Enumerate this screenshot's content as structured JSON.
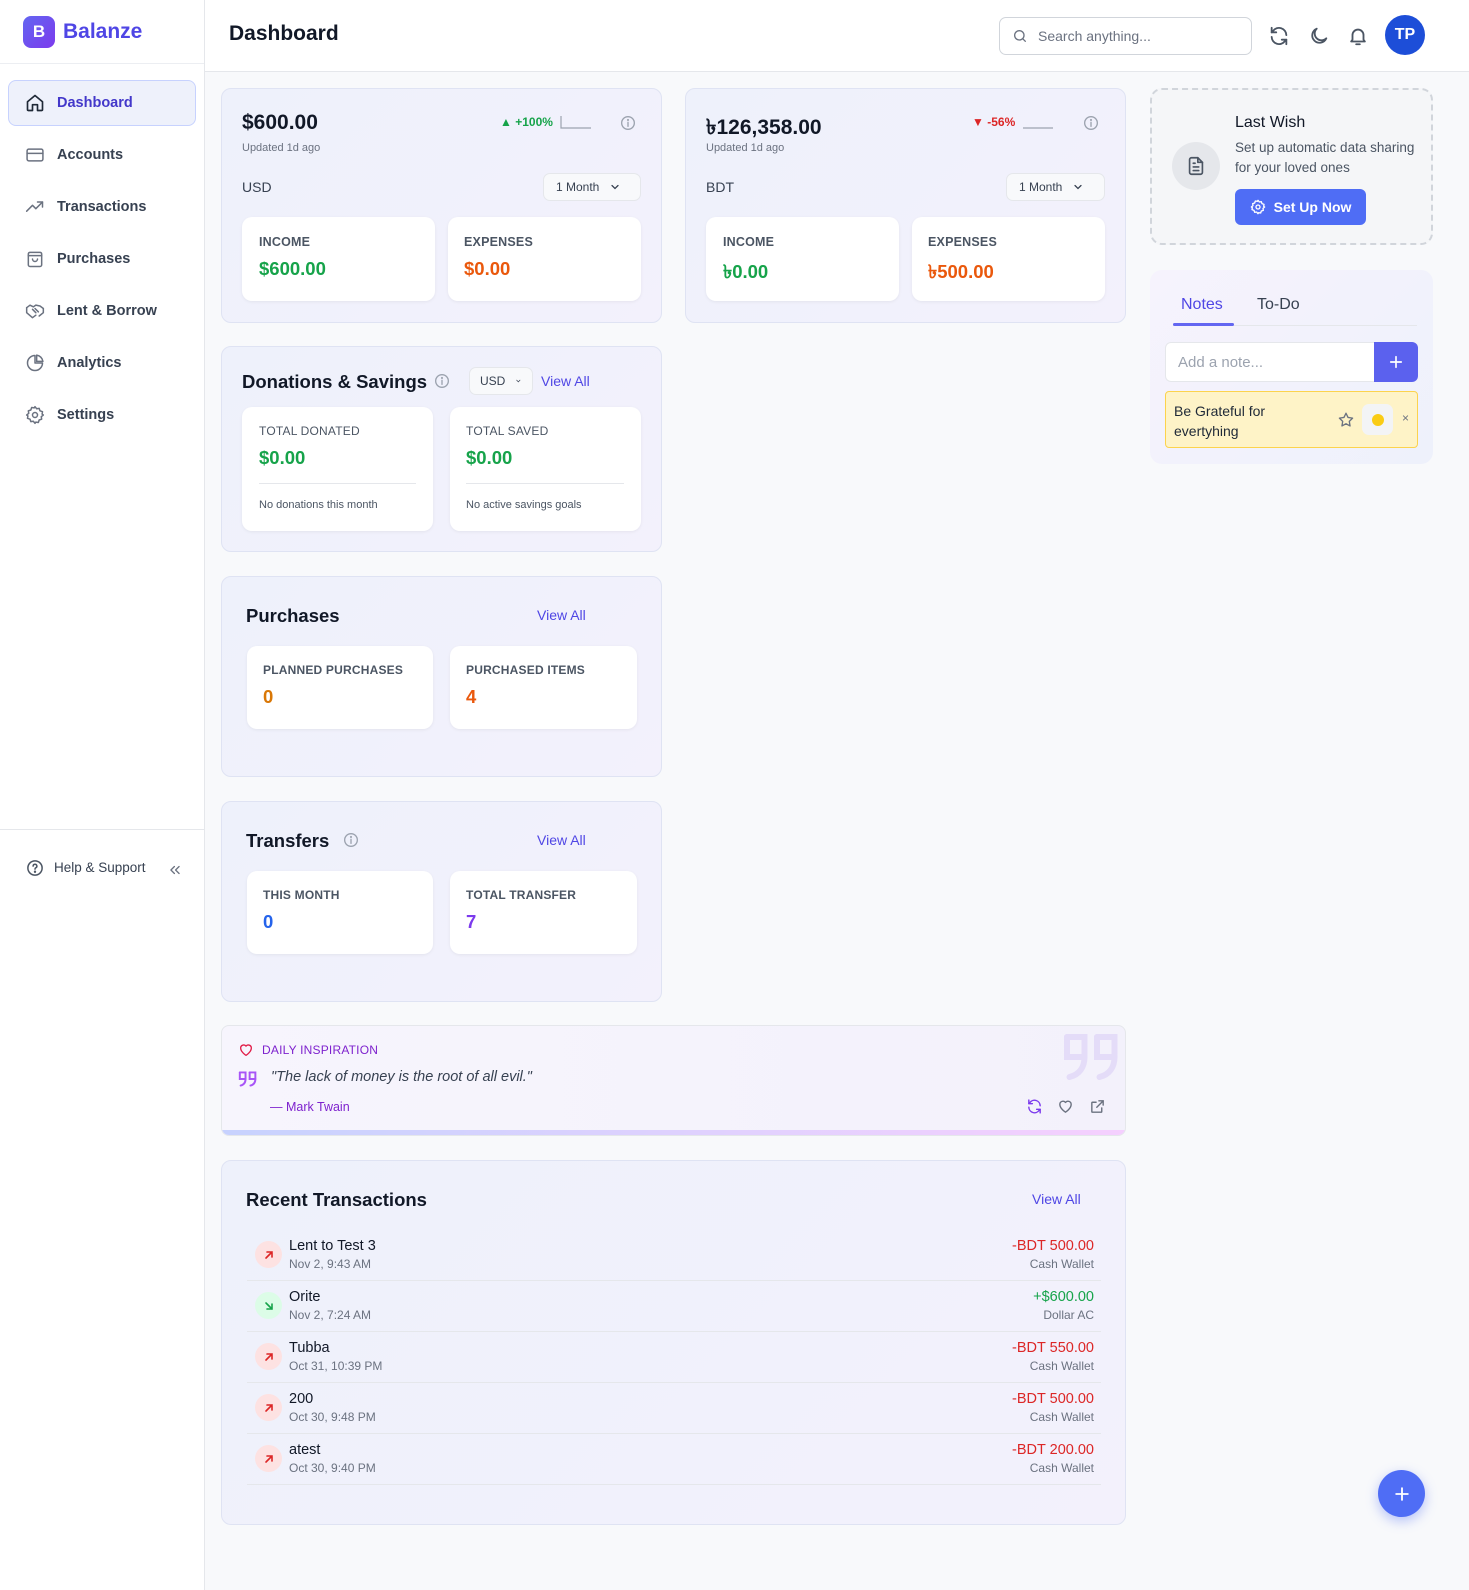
{
  "brand": {
    "logo_letter": "B",
    "name": "Balanze"
  },
  "sidebar": {
    "items": [
      {
        "label": "Dashboard",
        "icon": "home-icon",
        "active": true
      },
      {
        "label": "Accounts",
        "icon": "credit-card-icon"
      },
      {
        "label": "Transactions",
        "icon": "trending-up-icon"
      },
      {
        "label": "Purchases",
        "icon": "shopping-bag-icon"
      },
      {
        "label": "Lent & Borrow",
        "icon": "handshake-icon"
      },
      {
        "label": "Analytics",
        "icon": "pie-chart-icon"
      },
      {
        "label": "Settings",
        "icon": "gear-icon"
      }
    ],
    "help_label": "Help & Support"
  },
  "header": {
    "title": "Dashboard",
    "search_placeholder": "Search anything...",
    "avatar_initials": "TP"
  },
  "accounts": [
    {
      "amount": "$600.00",
      "trend": "+100%",
      "trend_dir": "up",
      "updated": "Updated 1d ago",
      "currency": "USD",
      "period": "1 Month",
      "income_label": "INCOME",
      "income": "$600.00",
      "expenses_label": "EXPENSES",
      "expenses": "$0.00"
    },
    {
      "amount": "৳126,358.00",
      "trend": "-56%",
      "trend_dir": "down",
      "updated": "Updated 1d ago",
      "currency": "BDT",
      "period": "1 Month",
      "income_label": "INCOME",
      "income": "৳0.00",
      "expenses_label": "EXPENSES",
      "expenses": "৳500.00"
    }
  ],
  "donations": {
    "title": "Donations & Savings",
    "currency": "USD",
    "view_all": "View All",
    "total_donated_label": "TOTAL DONATED",
    "total_donated": "$0.00",
    "donated_note": "No donations this month",
    "total_saved_label": "TOTAL SAVED",
    "total_saved": "$0.00",
    "saved_note": "No active savings goals"
  },
  "purchases": {
    "title": "Purchases",
    "view_all": "View All",
    "planned_label": "PLANNED PURCHASES",
    "planned": "0",
    "purchased_label": "PURCHASED ITEMS",
    "purchased": "4"
  },
  "transfers": {
    "title": "Transfers",
    "view_all": "View All",
    "this_month_label": "THIS MONTH",
    "this_month": "0",
    "total_label": "TOTAL TRANSFER",
    "total": "7"
  },
  "last_wish": {
    "title": "Last Wish",
    "description": "Set up automatic data sharing for your loved ones",
    "button": "Set Up Now"
  },
  "notes": {
    "tabs": [
      "Notes",
      "To-Do"
    ],
    "input_placeholder": "Add a note...",
    "items": [
      {
        "text": "Be Grateful for evertyhing",
        "color": "#facc15"
      }
    ],
    "close_glyph": "×"
  },
  "inspiration": {
    "label": "DAILY INSPIRATION",
    "quote": "\"The lack of money is the root of all evil.\"",
    "author": "— Mark Twain"
  },
  "recent_transactions": {
    "title": "Recent Transactions",
    "view_all": "View All",
    "items": [
      {
        "name": "Lent to Test 3",
        "date": "Nov 2, 9:43 AM",
        "amount": "-BDT 500.00",
        "account": "Cash Wallet",
        "direction": "out"
      },
      {
        "name": "Orite",
        "date": "Nov 2, 7:24 AM",
        "amount": "+$600.00",
        "account": "Dollar AC",
        "direction": "in"
      },
      {
        "name": "Tubba",
        "date": "Oct 31, 10:39 PM",
        "amount": "-BDT 550.00",
        "account": "Cash Wallet",
        "direction": "out"
      },
      {
        "name": "200",
        "date": "Oct 30, 9:48 PM",
        "amount": "-BDT 500.00",
        "account": "Cash Wallet",
        "direction": "out"
      },
      {
        "name": "atest",
        "date": "Oct 30, 9:40 PM",
        "amount": "-BDT 200.00",
        "account": "Cash Wallet",
        "direction": "out"
      }
    ]
  },
  "colors": {
    "accent": "#4f46e5",
    "income": "#16a34a",
    "expense": "#ea580c",
    "negative": "#dc2626"
  }
}
